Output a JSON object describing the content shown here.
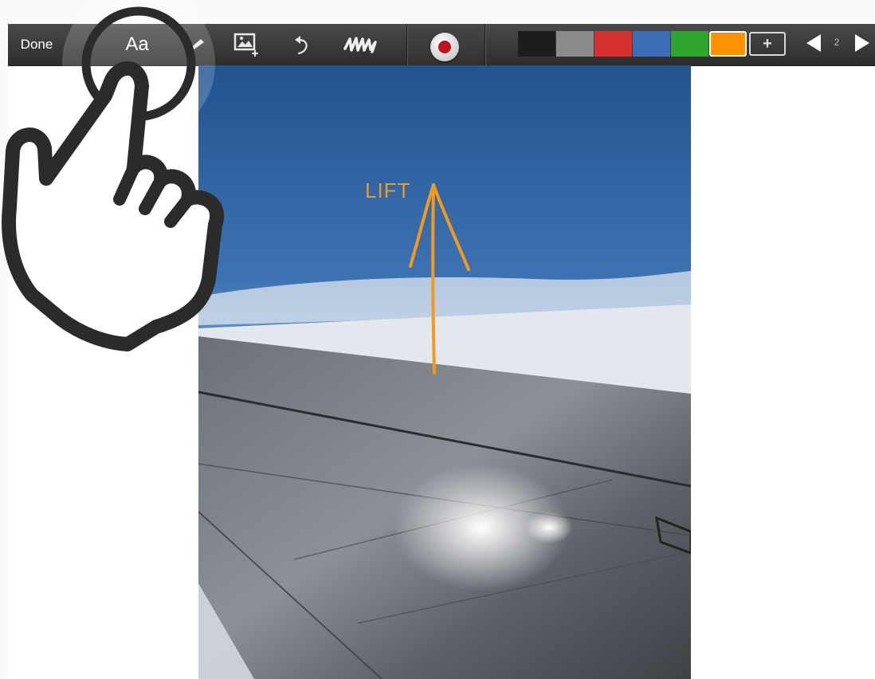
{
  "toolbar": {
    "done_label": "Done",
    "font_label": "Aa",
    "icons": [
      "pen-icon",
      "image-add-icon",
      "undo-icon",
      "scribble-eraser-icon",
      "record-icon"
    ],
    "colors": [
      "#1d1d1d",
      "#8a8a8a",
      "#d6302f",
      "#3a6fb7",
      "#2ea62e",
      "#ff9200"
    ],
    "selected_color": "#ff9200",
    "add_color_label": "+",
    "page_number": "2"
  },
  "canvas": {
    "annotation_text": "LIFT",
    "annotation_color": "#f39a1e"
  },
  "overlay": {
    "gesture": "tap-hand-icon"
  }
}
